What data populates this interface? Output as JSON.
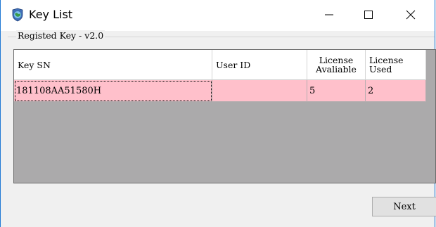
{
  "window": {
    "title": "Key List",
    "icon": "globe-shield-icon"
  },
  "controls": {
    "minimize": "—",
    "maximize": "☐",
    "close": "✕"
  },
  "group": {
    "label": "Registed Key - v2.0"
  },
  "grid": {
    "columns": [
      "Key SN",
      "User ID",
      "License\nAvaliable",
      "License\nUsed"
    ],
    "rows": [
      {
        "key_sn": "181108AA51580H",
        "user_id": "",
        "license_available": "5",
        "license_used": "2"
      }
    ],
    "selected_row_color": "#ffc0cb",
    "background_color": "#abaaab"
  },
  "buttons": {
    "next_label": "Next"
  }
}
